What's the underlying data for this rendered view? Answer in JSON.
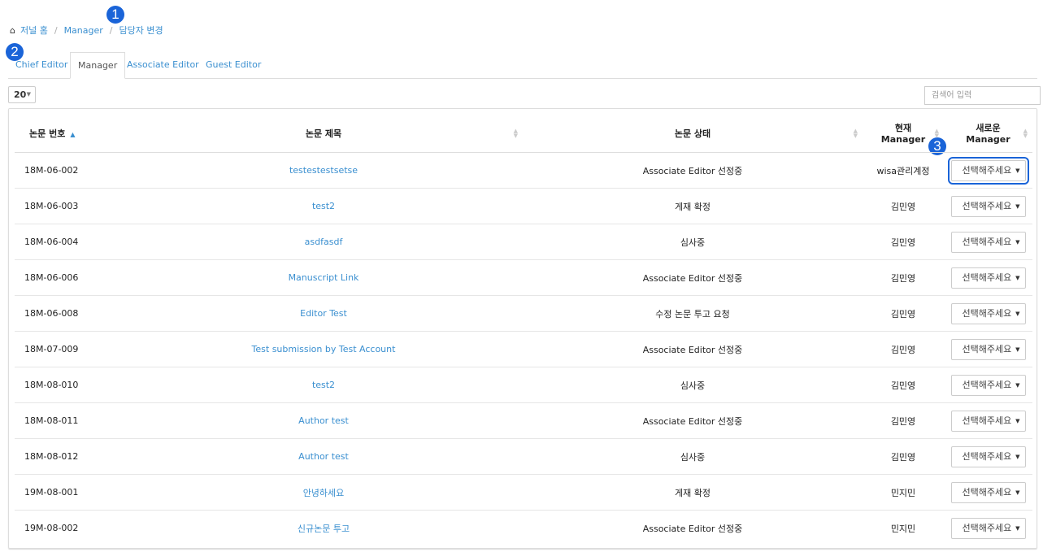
{
  "breadcrumb": {
    "home": "저널 홈",
    "section": "Manager",
    "current": "담당자 변경"
  },
  "markers": [
    "1",
    "2",
    "3"
  ],
  "tabs": [
    {
      "label": "Chief Editor",
      "active": false
    },
    {
      "label": "Manager",
      "active": true
    },
    {
      "label": "Associate Editor",
      "active": false
    },
    {
      "label": "Guest Editor",
      "active": false
    }
  ],
  "page_size": "20",
  "search": {
    "placeholder": "검색어 입력",
    "value": ""
  },
  "table": {
    "headers": {
      "id": "논문 번호",
      "title": "논문 제목",
      "status": "논문 상태",
      "current_manager": "현재 Manager",
      "new_manager": "새로운 Manager"
    },
    "select_placeholder": "선택해주세요",
    "rows": [
      {
        "id": "18M-06-002",
        "title": "testestestsetse",
        "status": "Associate Editor 선정중",
        "manager": "wisa관리계정"
      },
      {
        "id": "18M-06-003",
        "title": "test2",
        "status": "게재 확정",
        "manager": "김민영"
      },
      {
        "id": "18M-06-004",
        "title": "asdfasdf",
        "status": "심사중",
        "manager": "김민영"
      },
      {
        "id": "18M-06-006",
        "title": "Manuscript Link",
        "status": "Associate Editor 선정중",
        "manager": "김민영"
      },
      {
        "id": "18M-06-008",
        "title": "Editor Test",
        "status": "수정 논문 투고 요청",
        "manager": "김민영"
      },
      {
        "id": "18M-07-009",
        "title": "Test submission by Test Account",
        "status": "Associate Editor 선정중",
        "manager": "김민영"
      },
      {
        "id": "18M-08-010",
        "title": "test2",
        "status": "심사중",
        "manager": "김민영"
      },
      {
        "id": "18M-08-011",
        "title": "Author test",
        "status": "Associate Editor 선정중",
        "manager": "김민영"
      },
      {
        "id": "18M-08-012",
        "title": "Author test",
        "status": "심사중",
        "manager": "김민영"
      },
      {
        "id": "19M-08-001",
        "title": "안녕하세요",
        "status": "게재 확정",
        "manager": "민지민"
      },
      {
        "id": "19M-08-002",
        "title": "신규논문 투고",
        "status": "Associate Editor 선정중",
        "manager": "민지민"
      }
    ]
  },
  "colors": {
    "link": "#3a8fd0",
    "marker": "#1a64d8",
    "border": "#dddddd"
  }
}
